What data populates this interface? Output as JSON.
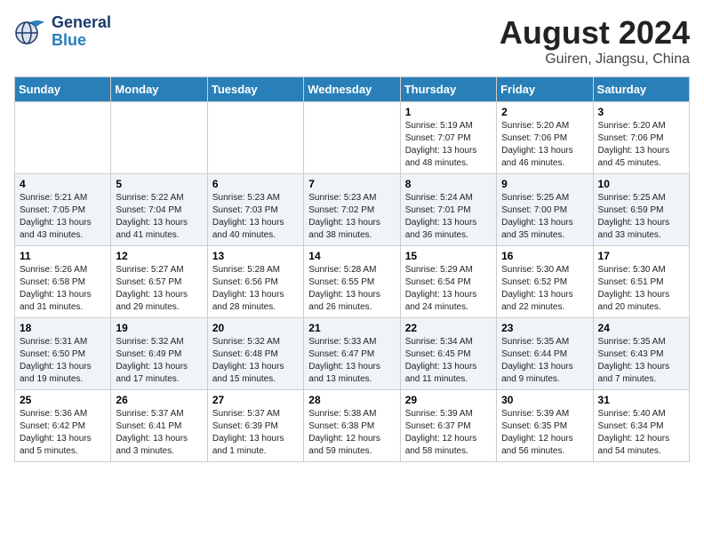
{
  "header": {
    "logo_line1": "General",
    "logo_line2": "Blue",
    "month_year": "August 2024",
    "location": "Guiren, Jiangsu, China"
  },
  "weekdays": [
    "Sunday",
    "Monday",
    "Tuesday",
    "Wednesday",
    "Thursday",
    "Friday",
    "Saturday"
  ],
  "weeks": [
    [
      {
        "day": "",
        "info": ""
      },
      {
        "day": "",
        "info": ""
      },
      {
        "day": "",
        "info": ""
      },
      {
        "day": "",
        "info": ""
      },
      {
        "day": "1",
        "info": "Sunrise: 5:19 AM\nSunset: 7:07 PM\nDaylight: 13 hours\nand 48 minutes."
      },
      {
        "day": "2",
        "info": "Sunrise: 5:20 AM\nSunset: 7:06 PM\nDaylight: 13 hours\nand 46 minutes."
      },
      {
        "day": "3",
        "info": "Sunrise: 5:20 AM\nSunset: 7:06 PM\nDaylight: 13 hours\nand 45 minutes."
      }
    ],
    [
      {
        "day": "4",
        "info": "Sunrise: 5:21 AM\nSunset: 7:05 PM\nDaylight: 13 hours\nand 43 minutes."
      },
      {
        "day": "5",
        "info": "Sunrise: 5:22 AM\nSunset: 7:04 PM\nDaylight: 13 hours\nand 41 minutes."
      },
      {
        "day": "6",
        "info": "Sunrise: 5:23 AM\nSunset: 7:03 PM\nDaylight: 13 hours\nand 40 minutes."
      },
      {
        "day": "7",
        "info": "Sunrise: 5:23 AM\nSunset: 7:02 PM\nDaylight: 13 hours\nand 38 minutes."
      },
      {
        "day": "8",
        "info": "Sunrise: 5:24 AM\nSunset: 7:01 PM\nDaylight: 13 hours\nand 36 minutes."
      },
      {
        "day": "9",
        "info": "Sunrise: 5:25 AM\nSunset: 7:00 PM\nDaylight: 13 hours\nand 35 minutes."
      },
      {
        "day": "10",
        "info": "Sunrise: 5:25 AM\nSunset: 6:59 PM\nDaylight: 13 hours\nand 33 minutes."
      }
    ],
    [
      {
        "day": "11",
        "info": "Sunrise: 5:26 AM\nSunset: 6:58 PM\nDaylight: 13 hours\nand 31 minutes."
      },
      {
        "day": "12",
        "info": "Sunrise: 5:27 AM\nSunset: 6:57 PM\nDaylight: 13 hours\nand 29 minutes."
      },
      {
        "day": "13",
        "info": "Sunrise: 5:28 AM\nSunset: 6:56 PM\nDaylight: 13 hours\nand 28 minutes."
      },
      {
        "day": "14",
        "info": "Sunrise: 5:28 AM\nSunset: 6:55 PM\nDaylight: 13 hours\nand 26 minutes."
      },
      {
        "day": "15",
        "info": "Sunrise: 5:29 AM\nSunset: 6:54 PM\nDaylight: 13 hours\nand 24 minutes."
      },
      {
        "day": "16",
        "info": "Sunrise: 5:30 AM\nSunset: 6:52 PM\nDaylight: 13 hours\nand 22 minutes."
      },
      {
        "day": "17",
        "info": "Sunrise: 5:30 AM\nSunset: 6:51 PM\nDaylight: 13 hours\nand 20 minutes."
      }
    ],
    [
      {
        "day": "18",
        "info": "Sunrise: 5:31 AM\nSunset: 6:50 PM\nDaylight: 13 hours\nand 19 minutes."
      },
      {
        "day": "19",
        "info": "Sunrise: 5:32 AM\nSunset: 6:49 PM\nDaylight: 13 hours\nand 17 minutes."
      },
      {
        "day": "20",
        "info": "Sunrise: 5:32 AM\nSunset: 6:48 PM\nDaylight: 13 hours\nand 15 minutes."
      },
      {
        "day": "21",
        "info": "Sunrise: 5:33 AM\nSunset: 6:47 PM\nDaylight: 13 hours\nand 13 minutes."
      },
      {
        "day": "22",
        "info": "Sunrise: 5:34 AM\nSunset: 6:45 PM\nDaylight: 13 hours\nand 11 minutes."
      },
      {
        "day": "23",
        "info": "Sunrise: 5:35 AM\nSunset: 6:44 PM\nDaylight: 13 hours\nand 9 minutes."
      },
      {
        "day": "24",
        "info": "Sunrise: 5:35 AM\nSunset: 6:43 PM\nDaylight: 13 hours\nand 7 minutes."
      }
    ],
    [
      {
        "day": "25",
        "info": "Sunrise: 5:36 AM\nSunset: 6:42 PM\nDaylight: 13 hours\nand 5 minutes."
      },
      {
        "day": "26",
        "info": "Sunrise: 5:37 AM\nSunset: 6:41 PM\nDaylight: 13 hours\nand 3 minutes."
      },
      {
        "day": "27",
        "info": "Sunrise: 5:37 AM\nSunset: 6:39 PM\nDaylight: 13 hours\nand 1 minute."
      },
      {
        "day": "28",
        "info": "Sunrise: 5:38 AM\nSunset: 6:38 PM\nDaylight: 12 hours\nand 59 minutes."
      },
      {
        "day": "29",
        "info": "Sunrise: 5:39 AM\nSunset: 6:37 PM\nDaylight: 12 hours\nand 58 minutes."
      },
      {
        "day": "30",
        "info": "Sunrise: 5:39 AM\nSunset: 6:35 PM\nDaylight: 12 hours\nand 56 minutes."
      },
      {
        "day": "31",
        "info": "Sunrise: 5:40 AM\nSunset: 6:34 PM\nDaylight: 12 hours\nand 54 minutes."
      }
    ]
  ]
}
